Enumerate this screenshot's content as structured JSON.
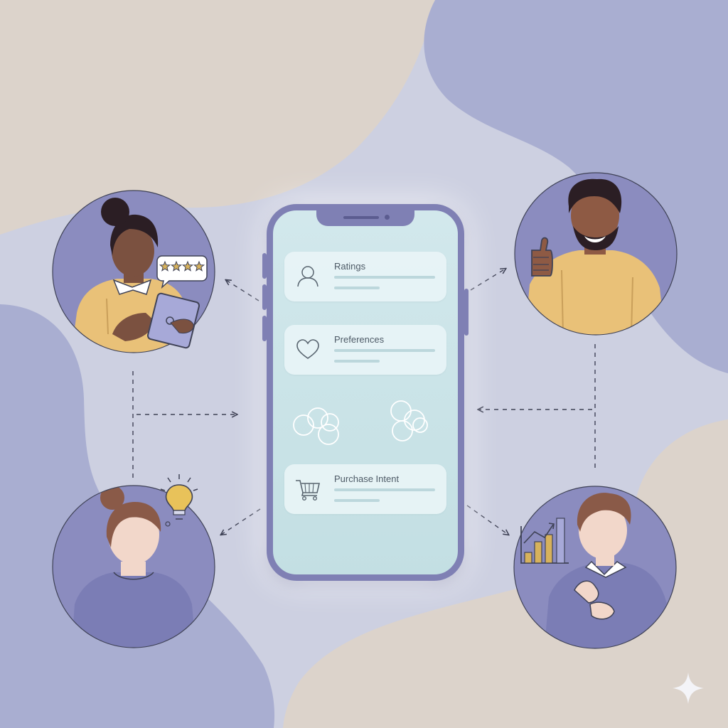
{
  "colors": {
    "background": "#cdd0e1",
    "blob_beige": "#dcd3cb",
    "blob_lavender": "#a9aed1",
    "avatar_circle": "#8b8cbf",
    "phone_frame": "#7f80b4",
    "phone_screen": "#c8e2e6",
    "card": "#e6f2f4",
    "mustard_shirt": "#e9c178",
    "accent_gold": "#d7b25c"
  },
  "phone": {
    "cards": [
      {
        "label": "Ratings",
        "icon": "user-icon"
      },
      {
        "label": "Preferences",
        "icon": "heart-icon"
      },
      {
        "label": "Purchase Intent",
        "icon": "shopping-cart-icon"
      }
    ],
    "middle_row_icons": [
      "overlapping-circles-icon",
      "overlapping-circles-icon"
    ]
  },
  "people": [
    {
      "role": "woman-with-tablet",
      "icons": [
        "star-rating-speech-bubble-icon",
        "tablet-icon"
      ]
    },
    {
      "role": "man-thumbs-up",
      "icons": [
        "thumbs-up-icon"
      ]
    },
    {
      "role": "woman-with-idea",
      "icons": [
        "lightbulb-icon"
      ]
    },
    {
      "role": "man-with-chart",
      "icons": [
        "bar-chart-icon"
      ]
    }
  ],
  "star_rating": {
    "stars_filled": 4,
    "stars_total": 4
  }
}
